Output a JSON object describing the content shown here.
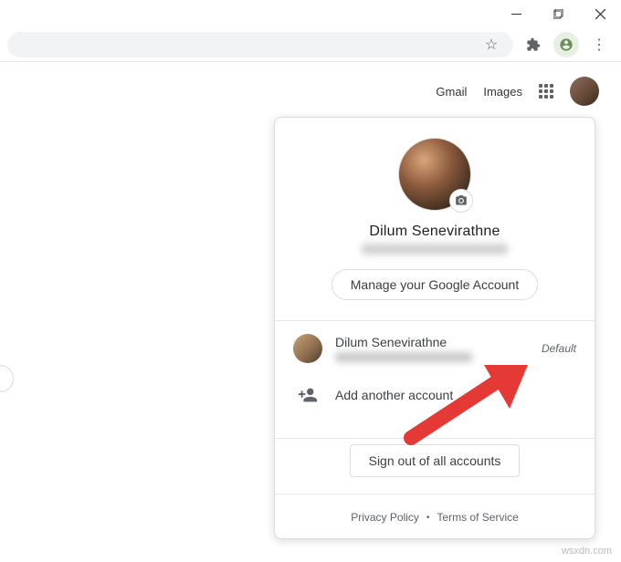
{
  "window_controls": {
    "minimize": "–",
    "maximize": "❐",
    "close": "✕"
  },
  "toolbar": {
    "star": "☆",
    "extensions": "✦",
    "menu": "⋮"
  },
  "page_header": {
    "gmail": "Gmail",
    "images": "Images"
  },
  "popup": {
    "name": "Dilum Senevirathne",
    "manage_label": "Manage your Google Account",
    "accounts": [
      {
        "name": "Dilum Senevirathne",
        "default_label": "Default"
      }
    ],
    "add_account_label": "Add another account",
    "signout_label": "Sign out of all accounts",
    "privacy_label": "Privacy Policy",
    "terms_label": "Terms of Service"
  },
  "watermark": "wsxdn.com"
}
